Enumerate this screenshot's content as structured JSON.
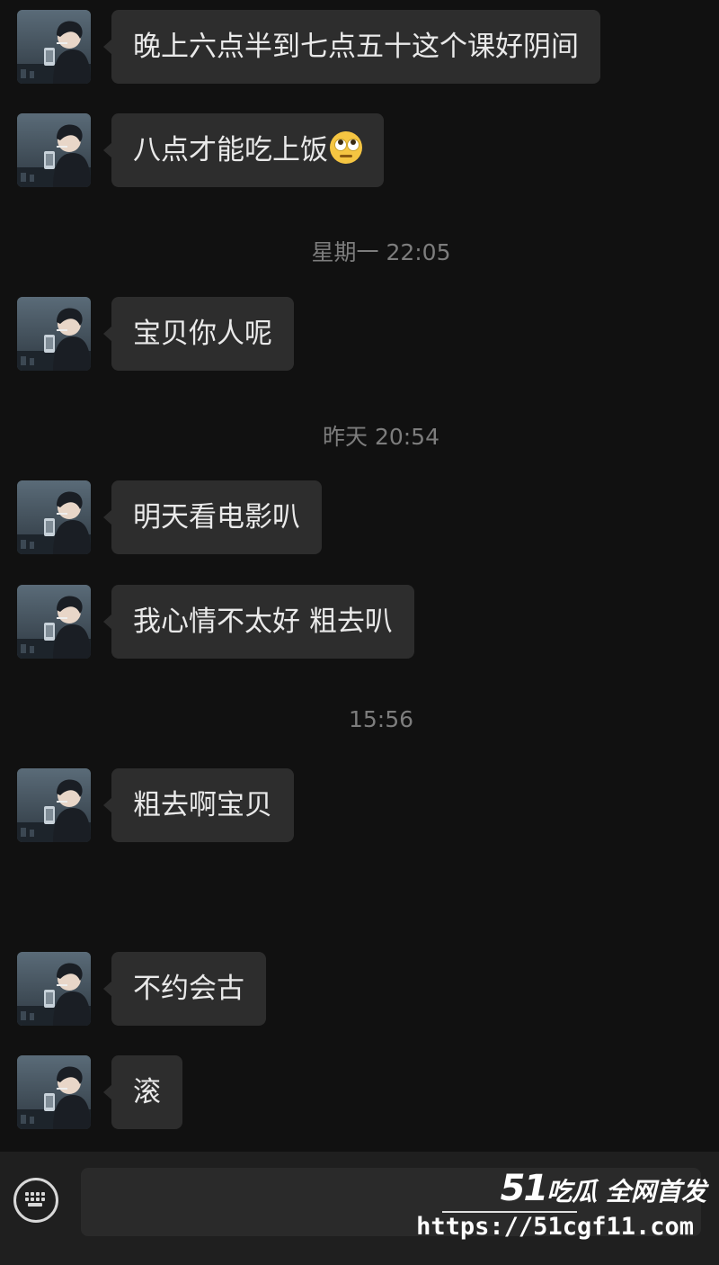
{
  "messages": [
    {
      "text": "晚上六点半到七点五十这个课好阴间"
    },
    {
      "text": "八点才能吃上饭",
      "emoji": "eye-roll-emoji"
    },
    {
      "text": "宝贝你人呢"
    },
    {
      "text": "明天看电影叭"
    },
    {
      "text": "我心情不太好 粗去叭"
    },
    {
      "text": "粗去啊宝贝"
    },
    {
      "text": "不约会古"
    },
    {
      "text": "滚"
    }
  ],
  "timestamps": [
    "星期一 22:05",
    "昨天 20:54",
    "15:56"
  ],
  "input_bar": {
    "keyboard_icon": "keyboard-icon"
  },
  "watermark": {
    "logo_number": "51",
    "logo_text": "吃瓜 全网首发",
    "url": "https://51cgf11.com"
  },
  "colors": {
    "background": "#111111",
    "bubble": "#2d2d2d",
    "timestamp_text": "#7d7d7d"
  }
}
